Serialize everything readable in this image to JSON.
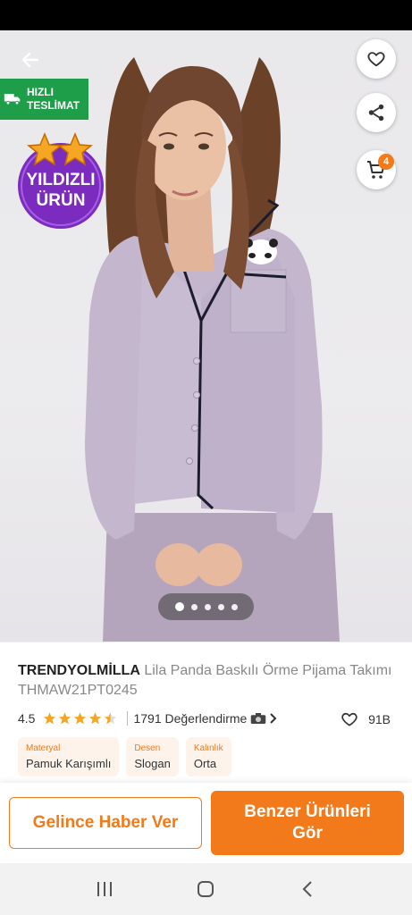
{
  "badges": {
    "fast_delivery_line1": "HIZLI",
    "fast_delivery_line2": "TESLİMAT",
    "starred_line1": "YILDIZLI",
    "starred_line2": "ÜRÜN"
  },
  "cart": {
    "count": "4"
  },
  "gallery": {
    "total_images": 5,
    "active_index": 0
  },
  "product": {
    "brand": "TRENDYOLMİLLA",
    "name": " Lila Panda Baskılı Örme Pijama Takımı THMAW21PT0245",
    "rating": "4.5",
    "rating_value": 4.5,
    "review_count": "1791 Değerlendirme",
    "favorite_count": "91B"
  },
  "attributes": [
    {
      "key": "Materyal",
      "value": "Pamuk Karışımlı"
    },
    {
      "key": "Desen",
      "value": "Slogan"
    },
    {
      "key": "Kalınlık",
      "value": "Orta"
    }
  ],
  "actions": {
    "notify_label": "Gelince Haber Ver",
    "similar_label": "Benzer Ürünleri Gör"
  },
  "colors": {
    "accent": "#f27a1a",
    "fast_delivery": "#1f9e49",
    "starred_badge": "#7b2cbf",
    "star": "#f5a623"
  },
  "icons": {
    "back": "arrow-left-icon",
    "favorite": "heart-icon",
    "share": "share-icon",
    "cart": "cart-icon",
    "truck": "truck-icon",
    "camera": "camera-icon",
    "chevron": "chevron-right-icon",
    "nav_recents": "recents-icon",
    "nav_home": "home-icon",
    "nav_back": "nav-back-icon"
  }
}
